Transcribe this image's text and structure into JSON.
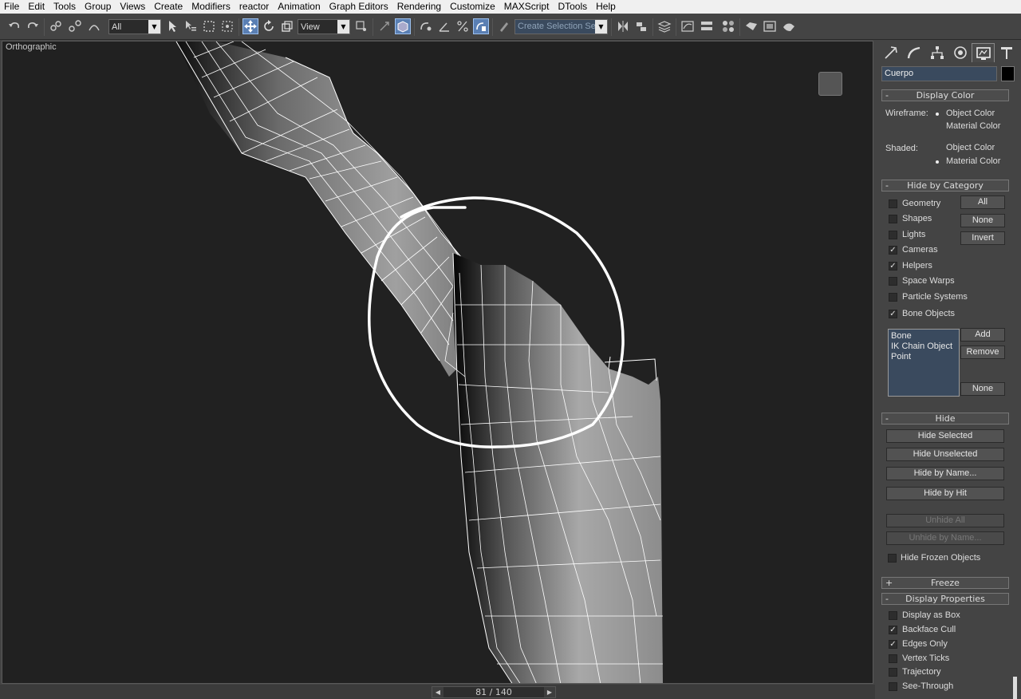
{
  "menu": [
    "File",
    "Edit",
    "Tools",
    "Group",
    "Views",
    "Create",
    "Modifiers",
    "reactor",
    "Animation",
    "Graph Editors",
    "Rendering",
    "Customize",
    "MAXScript",
    "DTools",
    "Help"
  ],
  "toolbar": {
    "selection_filter": "All",
    "reference_coord": "View",
    "named_selection_placeholder": "Create Selection Se"
  },
  "viewport": {
    "label": "Orthographic"
  },
  "timeline": {
    "frame_counter": "81 / 140"
  },
  "panel": {
    "object_name": "Cuerpo",
    "object_color": "#000000",
    "display_color": {
      "title": "Display Color",
      "wireframe_label": "Wireframe:",
      "shaded_label": "Shaded:",
      "object_color": "Object Color",
      "material_color": "Material Color",
      "wireframe_selected": "Object Color",
      "shaded_selected": "Material Color"
    },
    "hide_by_category": {
      "title": "Hide by Category",
      "categories": [
        {
          "label": "Geometry",
          "checked": false
        },
        {
          "label": "Shapes",
          "checked": false
        },
        {
          "label": "Lights",
          "checked": false
        },
        {
          "label": "Cameras",
          "checked": true
        },
        {
          "label": "Helpers",
          "checked": true
        },
        {
          "label": "Space Warps",
          "checked": false
        },
        {
          "label": "Particle Systems",
          "checked": false
        },
        {
          "label": "Bone Objects",
          "checked": true
        }
      ],
      "all_button": "All",
      "none_button": "None",
      "invert_button": "Invert",
      "list_items": [
        "Bone",
        "IK Chain Object",
        "Point"
      ],
      "add_button": "Add",
      "remove_button": "Remove",
      "list_none_button": "None"
    },
    "hide": {
      "title": "Hide",
      "hide_selected": "Hide Selected",
      "hide_unselected": "Hide Unselected",
      "hide_by_name": "Hide by Name...",
      "hide_by_hit": "Hide by Hit",
      "unhide_all": "Unhide All",
      "unhide_by_name": "Unhide by Name...",
      "hide_frozen": "Hide Frozen Objects"
    },
    "freeze": {
      "title": "Freeze"
    },
    "display_properties": {
      "title": "Display Properties",
      "items": [
        {
          "label": "Display as Box",
          "checked": false
        },
        {
          "label": "Backface Cull",
          "checked": true
        },
        {
          "label": "Edges Only",
          "checked": true
        },
        {
          "label": "Vertex Ticks",
          "checked": false
        },
        {
          "label": "Trajectory",
          "checked": false
        },
        {
          "label": "See-Through",
          "checked": false
        }
      ]
    }
  }
}
